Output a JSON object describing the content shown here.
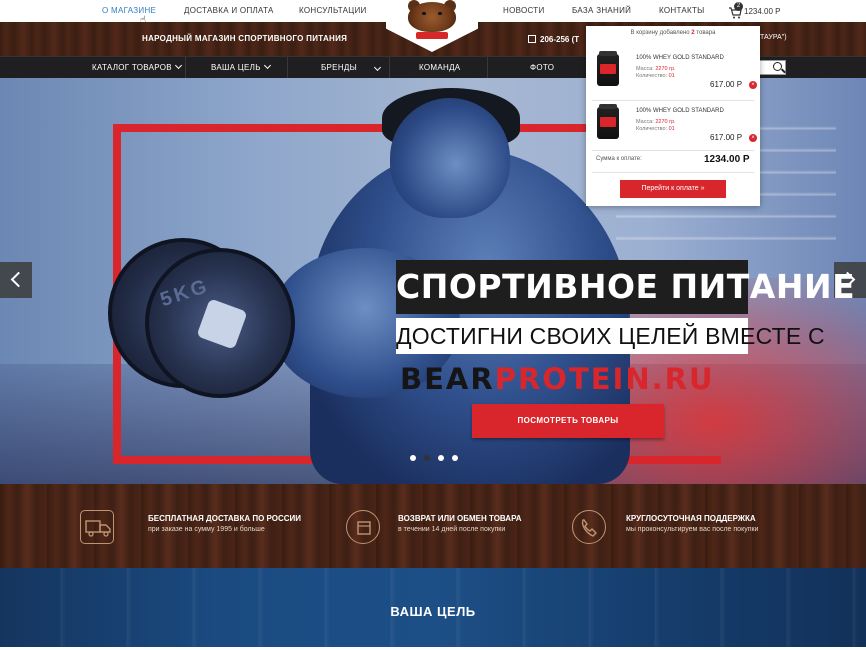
{
  "topnav": {
    "items": [
      {
        "label": "О МАГАЗИНЕ",
        "active": true
      },
      {
        "label": "ДОСТАВКА И ОПЛАТА",
        "active": false
      },
      {
        "label": "КОНСУЛЬТАЦИИ",
        "active": false
      },
      {
        "label": "НОВОСТИ",
        "active": false
      },
      {
        "label": "БАЗА ЗНАНИЙ",
        "active": false
      },
      {
        "label": "КОНТАКТЫ",
        "active": false
      }
    ],
    "cart_count": "2",
    "cart_total": "1234.00 Р"
  },
  "header": {
    "tagline": "НАРОДНЫЙ МАГАЗИН СПОРТИВНОГО ПИТАНИЯ",
    "phone": "206-256",
    "phone_suffix": "(Т",
    "address_suffix": "ТАУРА\")"
  },
  "mainnav": {
    "items": [
      {
        "label": "КАТАЛОГ ТОВАРОВ",
        "has_dropdown": true
      },
      {
        "label": "ВАША ЦЕЛЬ",
        "has_dropdown": true
      },
      {
        "label": "БРЕНДЫ",
        "has_dropdown": true
      },
      {
        "label": "КОМАНДА",
        "has_dropdown": false
      },
      {
        "label": "ФОТО",
        "has_dropdown": false
      }
    ]
  },
  "hero": {
    "title": "СПОРТИВНОЕ ПИТАНИЕ",
    "subtitle": "ДОСТИГНИ СВОИХ ЦЕЛЕЙ ВМЕСТЕ С",
    "brand_dark": "BEAR",
    "brand_red": "PROTEIN.RU",
    "button": "ПОСМОТРЕТЬ ТОВАРЫ",
    "dumbbell_label": "5KG",
    "slides": 4,
    "active_slide": 2
  },
  "cart_popup": {
    "header_pre": "В корзину добавлено",
    "header_count": "2",
    "header_post": "товара",
    "items": [
      {
        "name": "100% WHEY GOLD STANDARD",
        "mass_label": "Масса:",
        "mass": "2270 гр.",
        "qty_label": "Количество:",
        "qty": "01",
        "price": "617.00 Р"
      },
      {
        "name": "100% WHEY GOLD STANDARD",
        "mass_label": "Масса:",
        "mass": "2270 гр.",
        "qty_label": "Количество:",
        "qty": "01",
        "price": "617.00 Р"
      }
    ],
    "sum_label": "Сумма к оплате:",
    "sum_value": "1234.00 Р",
    "pay_button": "Перейти к оплате"
  },
  "features": [
    {
      "icon": "delivery-truck-icon",
      "title": "БЕСПЛАТНАЯ ДОСТАВКА ПО РОССИИ",
      "text": "при заказе на сумму 1995 и больше"
    },
    {
      "icon": "exchange-box-icon",
      "title": "ВОЗВРАТ ИЛИ ОБМЕН ТОВАРА",
      "text": "в течении 14 дней после покупки"
    },
    {
      "icon": "phone-support-icon",
      "title": "КРУГЛОСУТОЧНАЯ ПОДДЕРЖКА",
      "text": "мы проконсультируем вас после покупки"
    }
  ],
  "goal_section": {
    "title": "ВАША ЦЕЛЬ"
  },
  "colors": {
    "accent_red": "#d8262c",
    "link_blue": "#2d7fc1",
    "nav_dark": "#1f1f21"
  }
}
